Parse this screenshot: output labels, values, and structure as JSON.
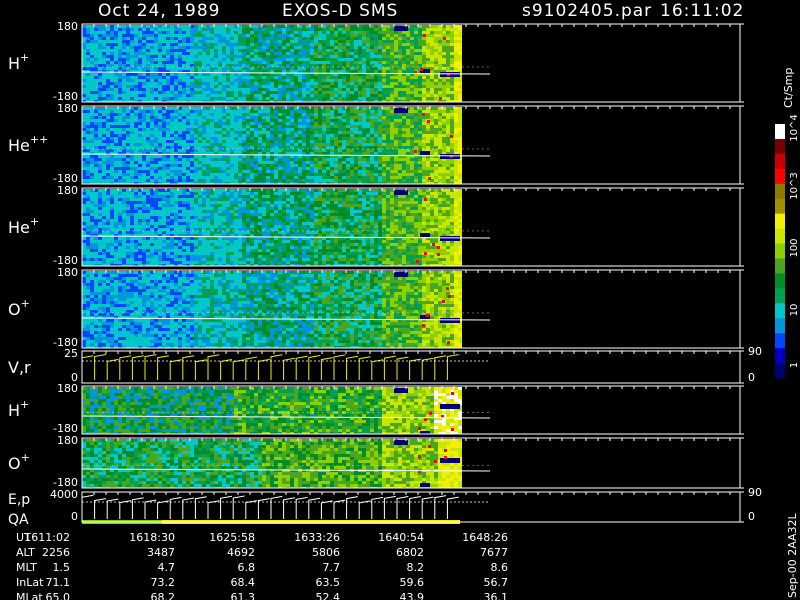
{
  "header": {
    "date": "Oct 24, 1989",
    "instrument": "EXOS-D SMS",
    "file": "s9102405.par",
    "time": "16:11:02"
  },
  "colorbar": {
    "unit_label": "Ct/Smp",
    "tick_labels": [
      "1",
      "10",
      "100",
      "10^3",
      "10^4"
    ],
    "colors": [
      "#00006e",
      "#0000c0",
      "#0046ff",
      "#0096dc",
      "#00c8c8",
      "#00a050",
      "#008c28",
      "#4aa520",
      "#8cd000",
      "#c8e600",
      "#f0f000",
      "#a09000",
      "#8a7a00",
      "#ff0000",
      "#c80000",
      "#780000",
      "#ffffff"
    ]
  },
  "side_label": "Sep-00  2AA32L",
  "ephemeris": {
    "rows": [
      "UT",
      "ALT",
      "MLT",
      "InLat",
      "MLat"
    ],
    "columns": [
      {
        "UT": "1611:02",
        "ALT": "2256",
        "MLT": "1.5",
        "InLat": "71.1",
        "MLat": "65.0"
      },
      {
        "UT": "1618:30",
        "ALT": "3487",
        "MLT": "4.7",
        "InLat": "73.2",
        "MLat": "68.2"
      },
      {
        "UT": "1625:58",
        "ALT": "4692",
        "MLT": "6.8",
        "InLat": "68.4",
        "MLat": "61.3"
      },
      {
        "UT": "1633:26",
        "ALT": "5806",
        "MLT": "7.7",
        "InLat": "63.5",
        "MLat": "52.4"
      },
      {
        "UT": "1640:54",
        "ALT": "6802",
        "MLT": "8.2",
        "InLat": "59.6",
        "MLat": "43.9"
      },
      {
        "UT": "1648:26",
        "ALT": "7677",
        "MLT": "8.6",
        "InLat": "56.7",
        "MLat": "36.1"
      }
    ]
  },
  "chart_data": [
    {
      "type": "heatmap",
      "label": "H",
      "sup": "+",
      "ymin": "-180",
      "ymax": "180",
      "scheme": "a"
    },
    {
      "type": "heatmap",
      "label": "He",
      "sup": "++",
      "ymin": "-180",
      "ymax": "180",
      "scheme": "a"
    },
    {
      "type": "heatmap",
      "label": "He",
      "sup": "+",
      "ymin": "-180",
      "ymax": "180",
      "scheme": "a"
    },
    {
      "type": "heatmap",
      "label": "O",
      "sup": "+",
      "ymin": "-180",
      "ymax": "180",
      "scheme": "a"
    },
    {
      "type": "line",
      "label": "V,r",
      "sup": "",
      "ymin": "0",
      "ymax": "25",
      "right_top": "90",
      "right_bottom": "0"
    },
    {
      "type": "heatmap",
      "label": "H",
      "sup": "+",
      "ymin": "-180",
      "ymax": "180",
      "scheme": "b"
    },
    {
      "type": "heatmap",
      "label": "O",
      "sup": "+",
      "ymin": "-180",
      "ymax": "180",
      "scheme": "c"
    },
    {
      "type": "line",
      "label": "E,p",
      "label2": "QA",
      "sup": "",
      "ymin": "0",
      "ymax": "4000",
      "right_top": "90",
      "right_bottom": "0"
    }
  ]
}
